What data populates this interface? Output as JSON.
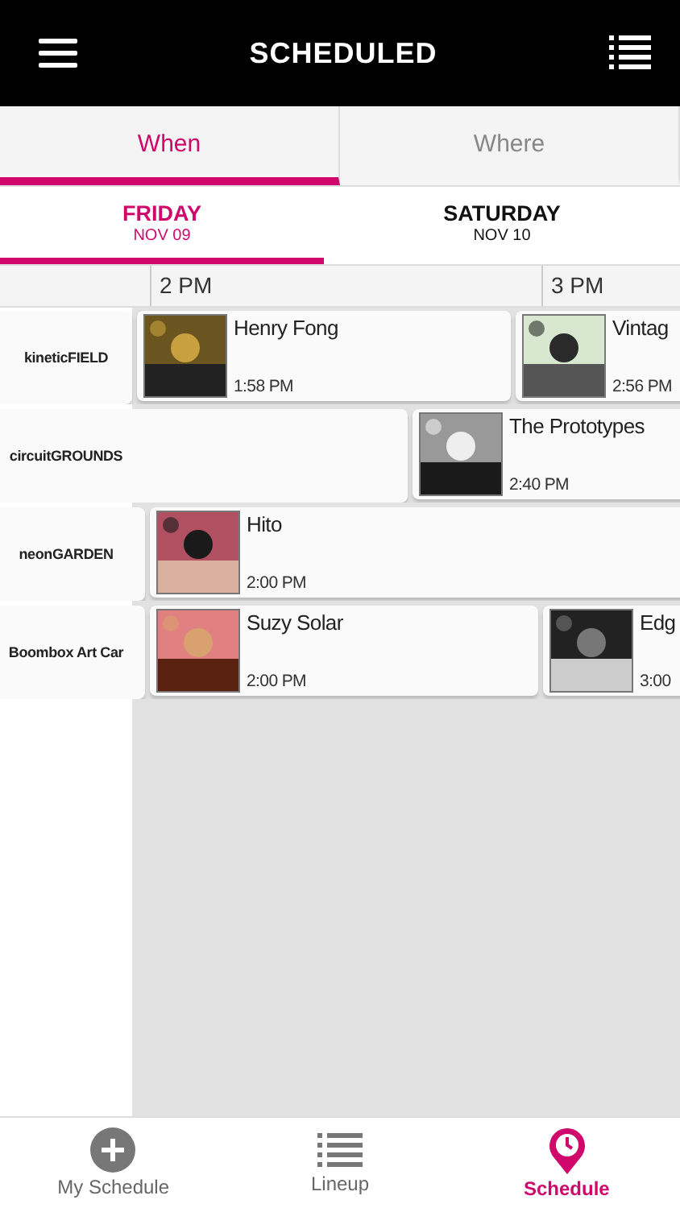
{
  "header": {
    "title": "SCHEDULED"
  },
  "view_tabs": [
    {
      "label": "When",
      "selected": true
    },
    {
      "label": "Where",
      "selected": false
    }
  ],
  "day_tabs": [
    {
      "day": "FRIDAY",
      "date": "NOV 09",
      "selected": true
    },
    {
      "day": "SATURDAY",
      "date": "NOV 10",
      "selected": false
    }
  ],
  "time_labels": [
    "2 PM",
    "3 PM"
  ],
  "stages": [
    {
      "name": "kineticFIELD",
      "events": [
        {
          "artist": "Henry Fong",
          "time": "1:58 PM"
        },
        {
          "artist": "Vintag",
          "time": "2:56 PM"
        }
      ]
    },
    {
      "name": "circuitGROUNDS",
      "events": [
        {
          "artist": "The Prototypes",
          "time": "2:40 PM"
        }
      ]
    },
    {
      "name": "neonGARDEN",
      "events": [
        {
          "artist": "Hito",
          "time": "2:00 PM"
        }
      ]
    },
    {
      "name": "Boombox Art Car",
      "events": [
        {
          "artist": "Suzy Solar",
          "time": "2:00 PM"
        },
        {
          "artist": "Edg",
          "time": "3:00"
        }
      ]
    }
  ],
  "bottom_nav": [
    {
      "label": "My Schedule",
      "selected": false
    },
    {
      "label": "Lineup",
      "selected": false
    },
    {
      "label": "Schedule",
      "selected": true
    }
  ]
}
